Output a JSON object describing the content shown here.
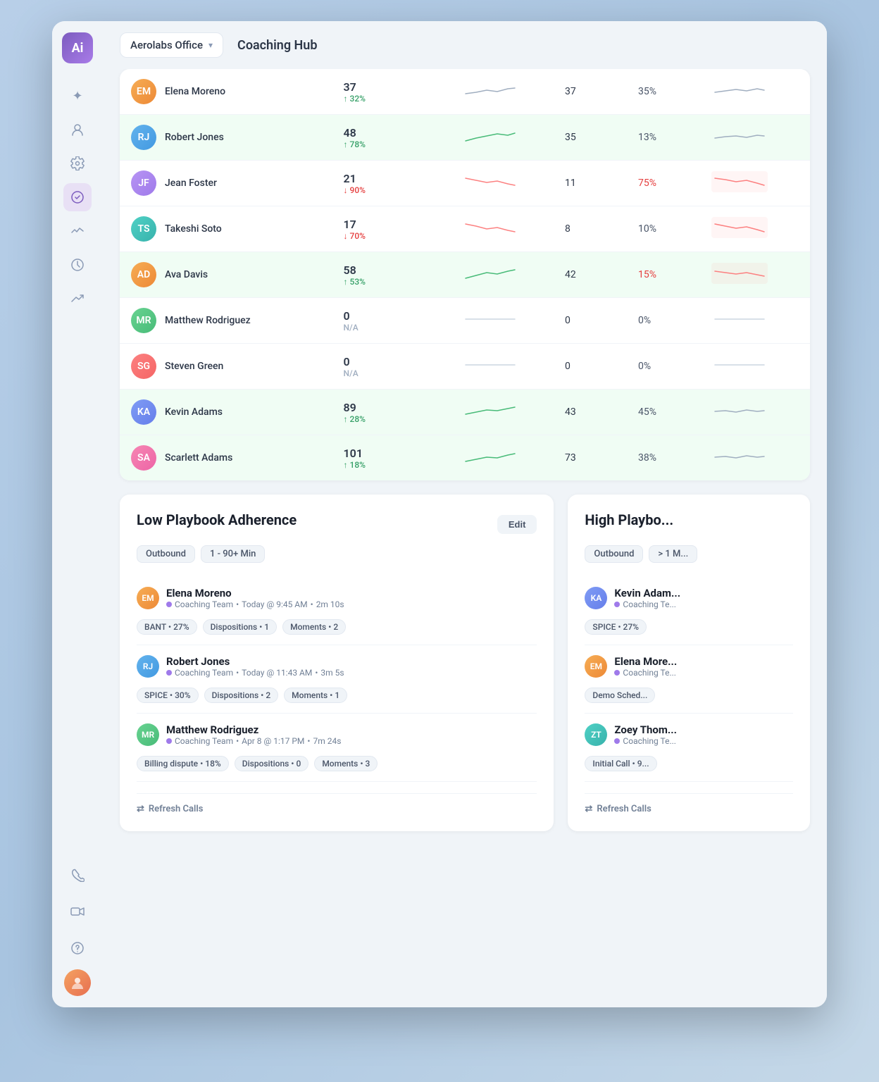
{
  "app": {
    "logo": "Ai",
    "workspace": "Aerolabs Office",
    "page_title": "Coaching Hub"
  },
  "sidebar": {
    "icons": [
      {
        "name": "sparkles-icon",
        "symbol": "✦",
        "active": false
      },
      {
        "name": "person-icon",
        "symbol": "👤",
        "active": false
      },
      {
        "name": "settings-icon",
        "symbol": "⚙",
        "active": false
      },
      {
        "name": "coaching-icon",
        "symbol": "🏅",
        "active": true
      },
      {
        "name": "activity-icon",
        "symbol": "⚡",
        "active": false
      },
      {
        "name": "history-icon",
        "symbol": "🕐",
        "active": false
      },
      {
        "name": "trending-icon",
        "symbol": "↗",
        "active": false
      }
    ],
    "bottom_icons": [
      {
        "name": "phone-icon",
        "symbol": "📞"
      },
      {
        "name": "video-icon",
        "symbol": "🎥"
      },
      {
        "name": "help-icon",
        "symbol": "❓"
      }
    ],
    "avatar_initials": "U"
  },
  "table": {
    "top_row": {
      "name": "Elena Moreno",
      "score": "37",
      "score_change": "↑ 32%",
      "score_direction": "up",
      "calls": "37",
      "adherence": "35%",
      "trend_color": "neutral"
    },
    "rows": [
      {
        "name": "Robert Jones",
        "score": "48",
        "score_change": "↑ 78%",
        "score_direction": "up",
        "calls": "35",
        "adherence": "13%",
        "adherence_color": "normal",
        "highlight": "green",
        "avatar_color": "av-blue"
      },
      {
        "name": "Jean Foster",
        "score": "21",
        "score_change": "↓ 90%",
        "score_direction": "down",
        "calls": "11",
        "adherence": "75%",
        "adherence_color": "red",
        "highlight": "neutral",
        "avatar_color": "av-purple"
      },
      {
        "name": "Takeshi Soto",
        "score": "17",
        "score_change": "↓ 70%",
        "score_direction": "down",
        "calls": "8",
        "adherence": "10%",
        "adherence_color": "normal",
        "highlight": "neutral",
        "avatar_color": "av-teal"
      },
      {
        "name": "Ava Davis",
        "score": "58",
        "score_change": "↑ 53%",
        "score_direction": "up",
        "calls": "42",
        "adherence": "15%",
        "adherence_color": "red",
        "highlight": "green",
        "avatar_color": "av-orange"
      },
      {
        "name": "Matthew Rodriguez",
        "score": "0",
        "score_change": "N/A",
        "score_direction": "na",
        "calls": "0",
        "adherence": "0%",
        "adherence_color": "normal",
        "highlight": "none",
        "avatar_color": "av-green"
      },
      {
        "name": "Steven Green",
        "score": "0",
        "score_change": "N/A",
        "score_direction": "na",
        "calls": "0",
        "adherence": "0%",
        "adherence_color": "normal",
        "highlight": "none",
        "avatar_color": "av-red"
      },
      {
        "name": "Kevin Adams",
        "score": "89",
        "score_change": "↑ 28%",
        "score_direction": "up",
        "calls": "43",
        "adherence": "45%",
        "adherence_color": "normal",
        "highlight": "green",
        "avatar_color": "av-indigo"
      },
      {
        "name": "Scarlett Adams",
        "score": "101",
        "score_change": "↑ 18%",
        "score_direction": "up",
        "calls": "73",
        "adherence": "38%",
        "adherence_color": "normal",
        "highlight": "green",
        "avatar_color": "av-pink"
      }
    ]
  },
  "low_playbook_card": {
    "title": "Low Playbook Adherence",
    "edit_label": "Edit",
    "filters": [
      "Outbound",
      "1 - 90+ Min"
    ],
    "calls": [
      {
        "name": "Elena Moreno",
        "team": "Coaching Team",
        "time": "Today @ 9:45 AM",
        "duration": "2m 10s",
        "tags": [
          "BANT • 27%",
          "Dispositions • 1",
          "Moments • 2"
        ],
        "avatar_color": "av-orange"
      },
      {
        "name": "Robert Jones",
        "team": "Coaching Team",
        "time": "Today @ 11:43 AM",
        "duration": "3m 5s",
        "tags": [
          "SPICE • 30%",
          "Dispositions • 2",
          "Moments • 1"
        ],
        "avatar_color": "av-blue"
      },
      {
        "name": "Matthew Rodriguez",
        "team": "Coaching Team",
        "time": "Apr 8 @ 1:17 PM",
        "duration": "7m 24s",
        "tags": [
          "Billing dispute • 18%",
          "Dispositions • 0",
          "Moments • 3"
        ],
        "avatar_color": "av-green"
      }
    ],
    "refresh_label": "Refresh Calls"
  },
  "high_playbook_card": {
    "title": "High Playbo...",
    "filters": [
      "Outbound",
      "> 1 M..."
    ],
    "calls": [
      {
        "name": "Kevin Adam...",
        "team": "Coaching Te...",
        "tag": "SPICE • 27%",
        "avatar_color": "av-indigo"
      },
      {
        "name": "Elena More...",
        "team": "Coaching Te...",
        "tag": "Demo Sched...",
        "avatar_color": "av-orange"
      },
      {
        "name": "Zoey Thom...",
        "team": "Coaching Te...",
        "tag": "Initial Call • 9...",
        "avatar_color": "av-teal"
      }
    ],
    "refresh_label": "Refresh Calls"
  }
}
